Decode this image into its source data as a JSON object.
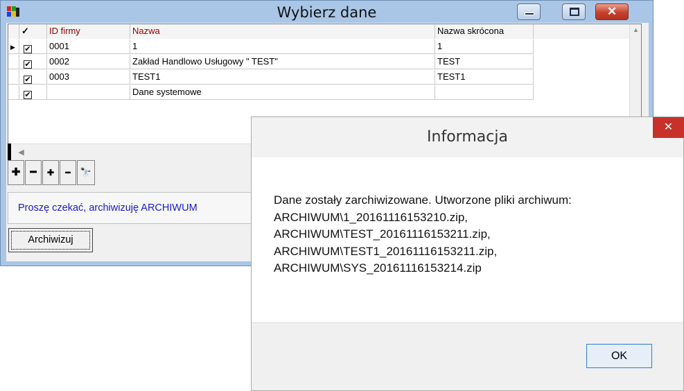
{
  "main_window": {
    "title": "Wybierz dane",
    "grid": {
      "columns": [
        "ID firmy",
        "Nazwa",
        "Nazwa skrócona"
      ],
      "rows": [
        {
          "id": "0001",
          "name": "1",
          "short": "1",
          "checked": "✔"
        },
        {
          "id": "0002",
          "name": "Zakład Handlowo Usługowy \" TEST\"",
          "short": "TEST",
          "checked": "✔"
        },
        {
          "id": "0003",
          "name": "TEST1",
          "short": "TEST1",
          "checked": "✔"
        },
        {
          "id": "",
          "name": "Dane systemowe",
          "short": "",
          "checked": "✔"
        }
      ],
      "check_header": "✓",
      "row_indicator": "▶"
    },
    "nav_buttons": [
      "✚",
      "━",
      "✚",
      "━",
      "🔭"
    ],
    "status_text": "Proszę czekać, archiwizuję ARCHIWUM",
    "archive_button": "Archiwizuj"
  },
  "dialog": {
    "title": "Informacja",
    "close": "✕",
    "message_lines": [
      "Dane zostały zarchiwizowane. Utworzone pliki archiwum:",
      "ARCHIWUM\\1_20161116153210.zip,",
      "ARCHIWUM\\TEST_20161116153211.zip,",
      "ARCHIWUM\\TEST1_20161116153211.zip,",
      "ARCHIWUM\\SYS_20161116153214.zip"
    ],
    "ok_label": "OK"
  },
  "colors": {
    "window_frame": "#a9c6e6",
    "header_text": "#8b0000",
    "status_text": "#1a1ac8",
    "dialog_close": "#c7312a"
  }
}
